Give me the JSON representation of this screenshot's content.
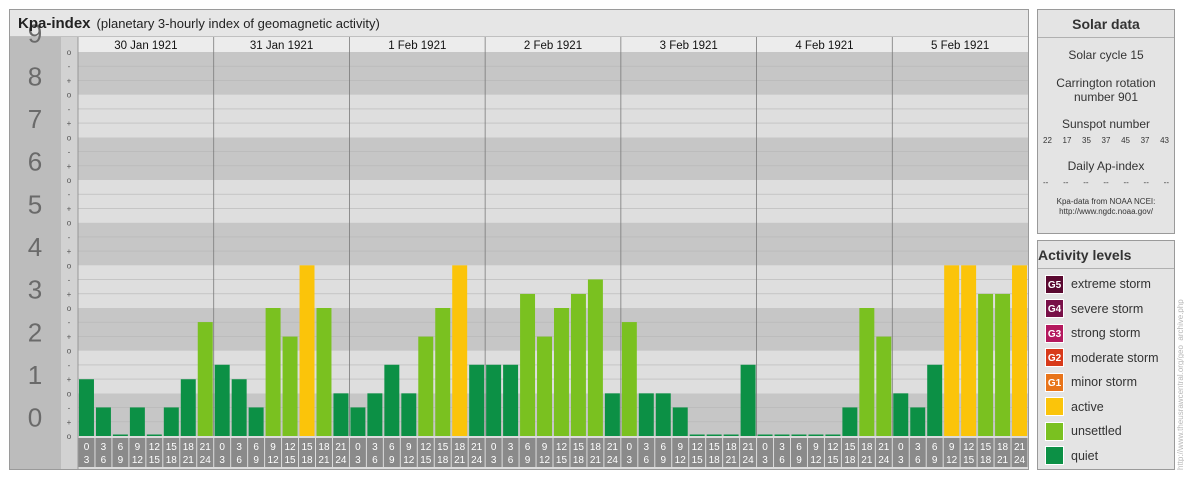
{
  "header": {
    "title": "Kpa-index",
    "subtitle": "(planetary 3-hourly index of geomagnetic activity)"
  },
  "chart_data": {
    "type": "bar",
    "ylim": [
      0,
      9
    ],
    "y_ticks": [
      "0",
      "1",
      "2",
      "3",
      "4",
      "5",
      "6",
      "7",
      "8",
      "9"
    ],
    "minor_tick_symbols": [
      "o",
      "+",
      "-"
    ],
    "days": [
      {
        "date": "30 Jan 1921",
        "values": [
          1.33,
          0.67,
          0.0,
          0.67,
          0.0,
          0.67,
          1.33,
          2.67
        ]
      },
      {
        "date": "31 Jan 1921",
        "values": [
          1.67,
          1.33,
          0.67,
          3.0,
          2.33,
          4.0,
          3.0,
          1.0
        ]
      },
      {
        "date": "1 Feb 1921",
        "values": [
          0.67,
          1.0,
          1.67,
          1.0,
          2.33,
          3.0,
          4.0,
          1.67
        ]
      },
      {
        "date": "2 Feb 1921",
        "values": [
          1.67,
          1.67,
          3.33,
          2.33,
          3.0,
          3.33,
          3.67,
          1.0
        ]
      },
      {
        "date": "3 Feb 1921",
        "values": [
          2.67,
          1.0,
          1.0,
          0.67,
          0.0,
          0.0,
          0.0,
          1.67
        ]
      },
      {
        "date": "4 Feb 1921",
        "values": [
          0.0,
          0.0,
          0.0,
          0.0,
          0.0,
          0.67,
          3.0,
          2.33
        ]
      },
      {
        "date": "5 Feb 1921",
        "values": [
          1.0,
          0.67,
          1.67,
          4.0,
          4.0,
          3.33,
          3.33,
          4.0
        ]
      }
    ],
    "interval_labels": [
      [
        "0",
        "3"
      ],
      [
        "3",
        "6"
      ],
      [
        "6",
        "9"
      ],
      [
        "9",
        "12"
      ],
      [
        "12",
        "15"
      ],
      [
        "15",
        "18"
      ],
      [
        "18",
        "21"
      ],
      [
        "21",
        "24"
      ]
    ],
    "bar_colors": {
      "quiet": "#0c9045",
      "unsettled": "#7ac120",
      "active": "#fbc40a"
    }
  },
  "solar": {
    "title": "Solar data",
    "cycle": "Solar cycle 15",
    "carrington_line1": "Carrington rotation",
    "carrington_line2": "number 901",
    "sunspot_title": "Sunspot number",
    "sunspot_values": [
      "22",
      "17",
      "35",
      "37",
      "45",
      "37",
      "43"
    ],
    "ap_title": "Daily Ap-index",
    "ap_values": [
      "--",
      "--",
      "--",
      "--",
      "--",
      "--",
      "--"
    ],
    "source_line1": "Kpa-data from NOAA NCEI:",
    "source_line2": "http://www.ngdc.noaa.gov/"
  },
  "activity": {
    "title": "Activity levels",
    "levels": [
      {
        "badge": "G5",
        "label": "extreme storm",
        "color": "#5a0930"
      },
      {
        "badge": "G4",
        "label": "severe storm",
        "color": "#781048"
      },
      {
        "badge": "G3",
        "label": "strong storm",
        "color": "#b4195e"
      },
      {
        "badge": "G2",
        "label": "moderate storm",
        "color": "#d83a1a"
      },
      {
        "badge": "G1",
        "label": "minor storm",
        "color": "#e8741a"
      },
      {
        "badge": "",
        "label": "active",
        "color": "#fbc40a"
      },
      {
        "badge": "",
        "label": "unsettled",
        "color": "#7ac120"
      },
      {
        "badge": "",
        "label": "quiet",
        "color": "#0c9045"
      }
    ]
  },
  "credit": "http://www.theusrawcentral.org/geo_archive.php"
}
